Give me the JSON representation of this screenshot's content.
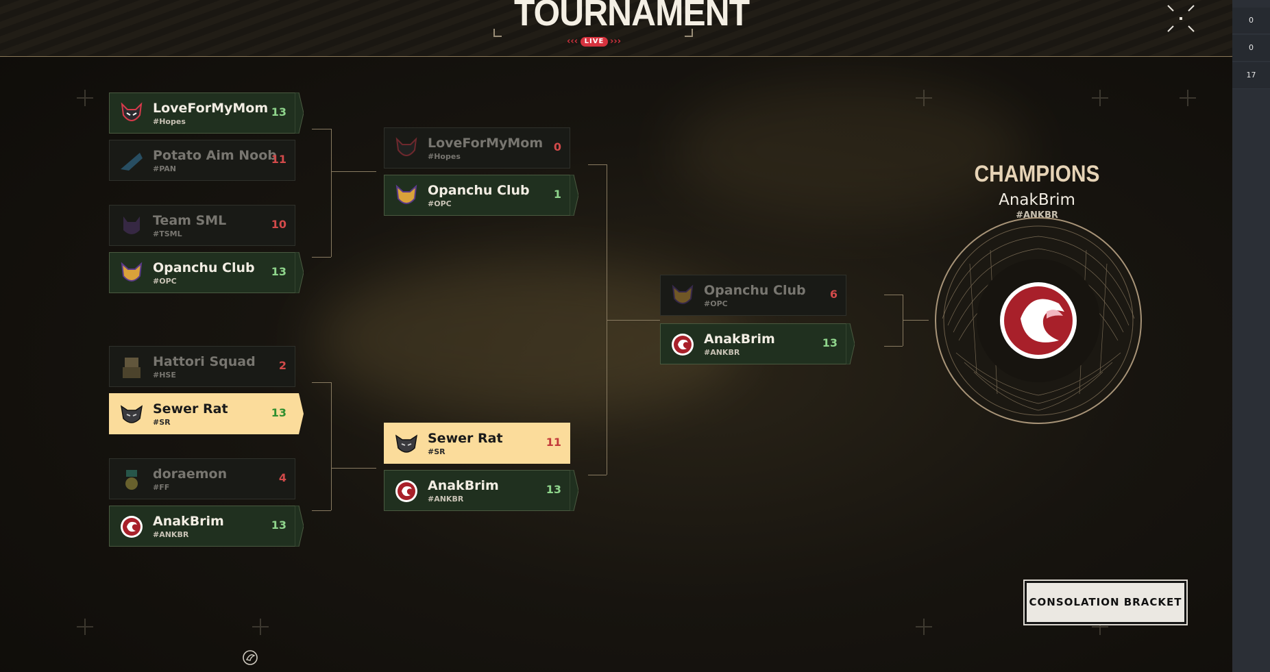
{
  "header": {
    "title": "TOURNAMENT",
    "live_label": "LIVE"
  },
  "side_panel": {
    "values": [
      "0",
      "0",
      "17"
    ]
  },
  "teams": {
    "loveformymom": {
      "name": "LoveForMyMom",
      "tag": "#Hopes"
    },
    "potato": {
      "name": "Potato Aim Noob",
      "tag": "#PAN"
    },
    "teamsml": {
      "name": "Team SML",
      "tag": "#TSML"
    },
    "opanchu": {
      "name": "Opanchu Club",
      "tag": "#OPC"
    },
    "hattori": {
      "name": "Hattori Squad",
      "tag": "#HSE"
    },
    "sewer": {
      "name": "Sewer Rat",
      "tag": "#SR"
    },
    "doraemon": {
      "name": "doraemon",
      "tag": "#FF"
    },
    "anak": {
      "name": "AnakBrim",
      "tag": "#ANKBR"
    }
  },
  "rounds": {
    "r1": [
      {
        "a": {
          "team": "LoveForMyMom",
          "tag": "#Hopes",
          "score": "13"
        },
        "b": {
          "team": "Potato Aim Noob",
          "tag": "#PAN",
          "score": "11"
        }
      },
      {
        "a": {
          "team": "Team SML",
          "tag": "#TSML",
          "score": "10"
        },
        "b": {
          "team": "Opanchu Club",
          "tag": "#OPC",
          "score": "13"
        }
      },
      {
        "a": {
          "team": "Hattori Squad",
          "tag": "#HSE",
          "score": "2"
        },
        "b": {
          "team": "Sewer Rat",
          "tag": "#SR",
          "score": "13"
        }
      },
      {
        "a": {
          "team": "doraemon",
          "tag": "#FF",
          "score": "4"
        },
        "b": {
          "team": "AnakBrim",
          "tag": "#ANKBR",
          "score": "13"
        }
      }
    ],
    "r2": [
      {
        "a": {
          "team": "LoveForMyMom",
          "tag": "#Hopes",
          "score": "0"
        },
        "b": {
          "team": "Opanchu Club",
          "tag": "#OPC",
          "score": "1"
        }
      },
      {
        "a": {
          "team": "Sewer Rat",
          "tag": "#SR",
          "score": "11"
        },
        "b": {
          "team": "AnakBrim",
          "tag": "#ANKBR",
          "score": "13"
        }
      }
    ],
    "final": [
      {
        "a": {
          "team": "Opanchu Club",
          "tag": "#OPC",
          "score": "6"
        },
        "b": {
          "team": "AnakBrim",
          "tag": "#ANKBR",
          "score": "13"
        }
      }
    ]
  },
  "champion": {
    "label": "CHAMPIONS",
    "name": "AnakBrim",
    "tag": "#ANKBR"
  },
  "consolation_button": "CONSOLATION BRACKET",
  "colors": {
    "highlight": "#fbdc9b",
    "win_score": "#8fd58c",
    "loss_score": "#d24a4a",
    "live": "#d6333f"
  }
}
